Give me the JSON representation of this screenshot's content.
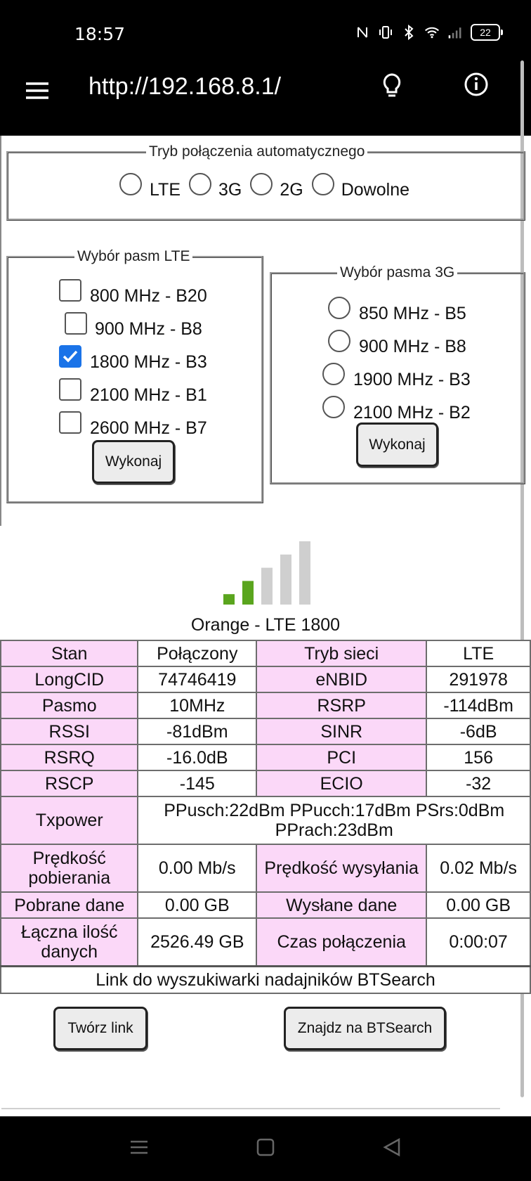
{
  "status": {
    "time": "18:57",
    "battery": "22"
  },
  "appbar": {
    "url": "http://192.168.8.1/"
  },
  "auto_mode": {
    "legend": "Tryb połączenia automatycznego",
    "options": [
      "LTE",
      "3G",
      "2G",
      "Dowolne"
    ]
  },
  "lte_bands": {
    "legend": "Wybór pasm LTE",
    "items": [
      {
        "label": "800 MHz - B20",
        "checked": false
      },
      {
        "label": "900 MHz - B8",
        "checked": false
      },
      {
        "label": "1800 MHz - B3",
        "checked": true
      },
      {
        "label": "2100 MHz - B1",
        "checked": false
      },
      {
        "label": "2600 MHz - B7",
        "checked": false
      }
    ],
    "button": "Wykonaj"
  },
  "bands_3g": {
    "legend": "Wybór pasma 3G",
    "items": [
      "850 MHz - B5",
      "900 MHz - B8",
      "1900 MHz - B3",
      "2100 MHz - B2"
    ],
    "button": "Wykonaj"
  },
  "signal": {
    "bars_active": 2,
    "bars_total": 5,
    "active_color": "#5aa51e",
    "inactive_color": "#cfcfcf",
    "caption": "Orange - LTE 1800"
  },
  "table": {
    "rows": [
      [
        "Stan",
        "Połączony",
        "Tryb sieci",
        "LTE"
      ],
      [
        "LongCID",
        "74746419",
        "eNBID",
        "291978"
      ],
      [
        "Pasmo",
        "10MHz",
        "RSRP",
        "-114dBm"
      ],
      [
        "RSSI",
        "-81dBm",
        "SINR",
        "-6dB"
      ],
      [
        "RSRQ",
        "-16.0dB",
        "PCI",
        "156"
      ],
      [
        "RSCP",
        "-145",
        "ECIO",
        "-32"
      ]
    ],
    "txpower_label": "Txpower",
    "txpower_value": "PPusch:22dBm PPucch:17dBm PSrs:0dBm PPrach:23dBm",
    "rows2": [
      [
        "Prędkość pobierania",
        "0.00 Mb/s",
        "Prędkość wysyłania",
        "0.02 Mb/s"
      ],
      [
        "Pobrane dane",
        "0.00 GB",
        "Wysłane dane",
        "0.00 GB"
      ],
      [
        "Łączna ilość danych",
        "2526.49 GB",
        "Czas połączenia",
        "0:00:07"
      ]
    ]
  },
  "btsearch": {
    "title": "Link do wyszukiwarki nadajników BTSearch",
    "create_button": "Twórz link",
    "find_button": "Znajdz na BTSearch"
  },
  "colors": {
    "label_bg": "#fbd8f8",
    "checkbox_on": "#1a73e8"
  }
}
